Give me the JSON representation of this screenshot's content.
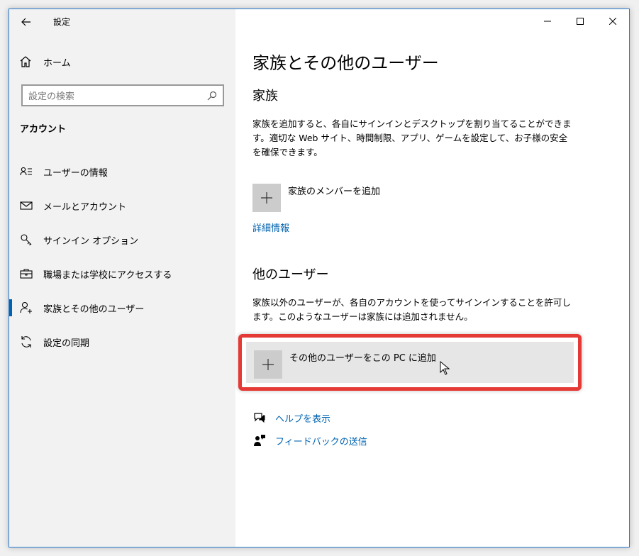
{
  "window": {
    "title": "設定"
  },
  "sidebar": {
    "home_label": "ホーム",
    "search_placeholder": "設定の検索",
    "section_label": "アカウント",
    "items": [
      {
        "label": "ユーザーの情報",
        "icon": "user-info-icon"
      },
      {
        "label": "メールとアカウント",
        "icon": "mail-icon"
      },
      {
        "label": "サインイン オプション",
        "icon": "key-icon"
      },
      {
        "label": "職場または学校にアクセスする",
        "icon": "briefcase-icon"
      },
      {
        "label": "家族とその他のユーザー",
        "icon": "person-add-icon",
        "active": true
      },
      {
        "label": "設定の同期",
        "icon": "sync-icon"
      }
    ]
  },
  "main": {
    "title": "家族とその他のユーザー",
    "family": {
      "heading": "家族",
      "description": "家族を追加すると、各自にサインインとデスクトップを割り当てることができます。適切な Web サイト、時間制限、アプリ、ゲームを設定して、お子様の安全を確保できます。",
      "add_label": "家族のメンバーを追加",
      "details_link": "詳細情報"
    },
    "others": {
      "heading": "他のユーザー",
      "description": "家族以外のユーザーが、各自のアカウントを使ってサインインすることを許可します。このようなユーザーは家族には追加されません。",
      "add_label": "その他のユーザーをこの PC に追加"
    },
    "help_link": "ヘルプを表示",
    "feedback_link": "フィードバックの送信"
  },
  "colors": {
    "accent": "#0063b1",
    "highlight": "#e53935"
  }
}
